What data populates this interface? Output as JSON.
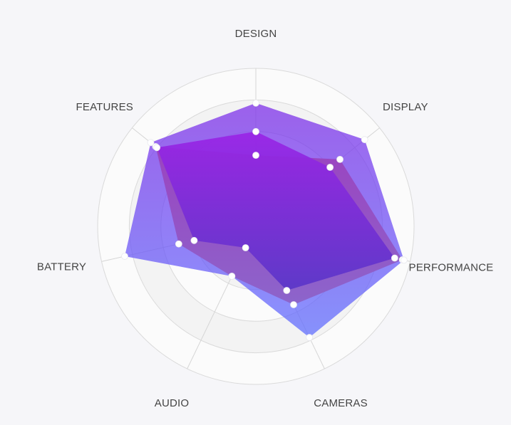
{
  "chart_data": {
    "type": "radar",
    "axes": [
      "DESIGN",
      "DISPLAY",
      "PERFORMANCE",
      "CAMERAS",
      "AUDIO",
      "BATTERY",
      "FEATURES"
    ],
    "range": [
      0,
      100
    ],
    "rings": 5,
    "grid": true,
    "legend": "none",
    "series": [
      {
        "values": [
          45,
          68,
          95,
          55,
          35,
          50,
          81
        ],
        "color": "#ff6a4d"
      },
      {
        "values": [
          60,
          60,
          90,
          45,
          15,
          40,
          80
        ],
        "color": "#a020d8"
      },
      {
        "values": [
          78,
          88,
          96,
          78,
          35,
          85,
          85
        ],
        "color": "#6b6cff"
      }
    ]
  }
}
